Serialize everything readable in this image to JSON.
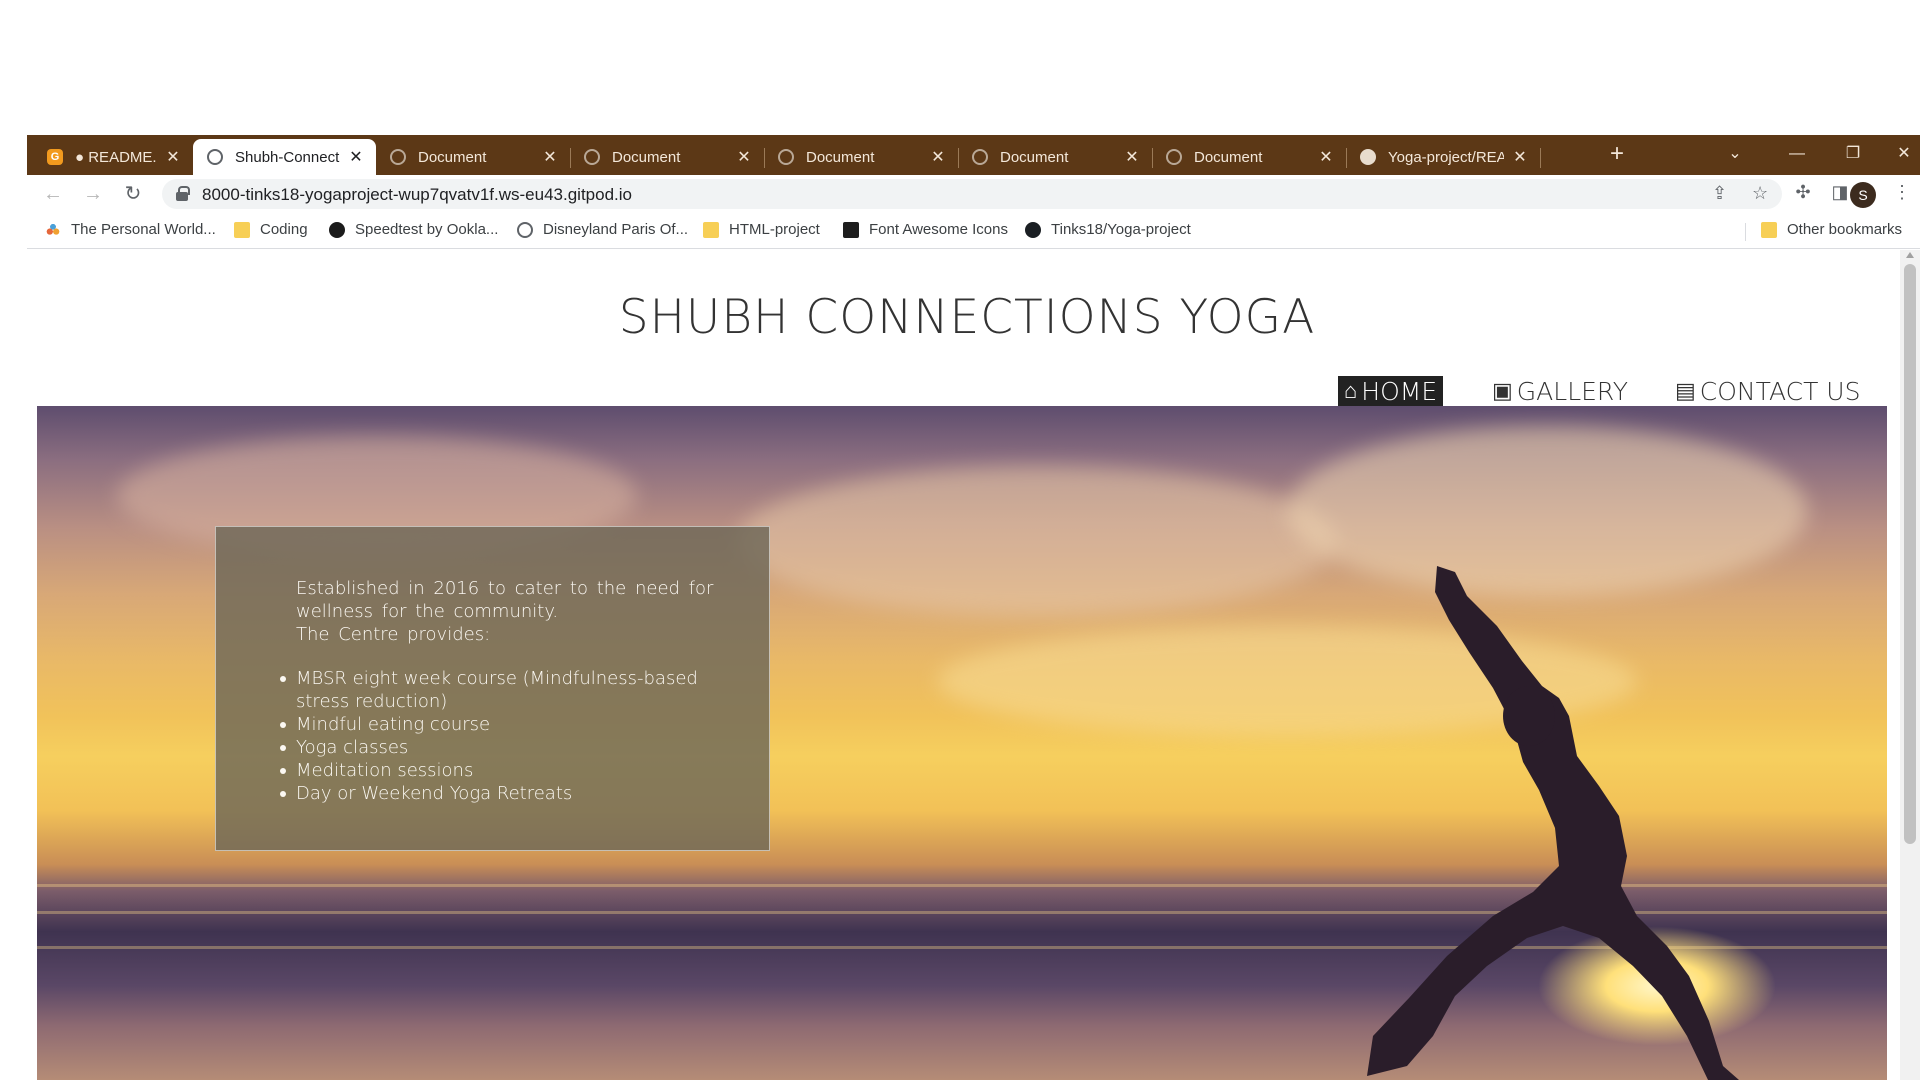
{
  "browser": {
    "tabs": [
      {
        "title": "● README.md - Y",
        "icon": "gitpod-icon",
        "active": false
      },
      {
        "title": "Shubh-Connectio",
        "icon": "globe-icon",
        "active": true
      },
      {
        "title": "Document",
        "icon": "globe-icon",
        "active": false
      },
      {
        "title": "Document",
        "icon": "globe-icon",
        "active": false
      },
      {
        "title": "Document",
        "icon": "globe-icon",
        "active": false
      },
      {
        "title": "Document",
        "icon": "globe-icon",
        "active": false
      },
      {
        "title": "Document",
        "icon": "globe-icon",
        "active": false
      },
      {
        "title": "Yoga-project/REA",
        "icon": "github-icon",
        "active": false
      }
    ],
    "url": "8000-tinks18-yogaproject-wup7qvatv1f.ws-eu43.gitpod.io",
    "profile_initial": "S",
    "bookmarks": [
      {
        "label": "The Personal World...",
        "icon": "personal-world-icon"
      },
      {
        "label": "Coding",
        "icon": "folder-icon"
      },
      {
        "label": "Speedtest by Ookla...",
        "icon": "speedtest-icon"
      },
      {
        "label": "Disneyland Paris Of...",
        "icon": "globe-icon"
      },
      {
        "label": "HTML-project",
        "icon": "folder-icon"
      },
      {
        "label": "Font Awesome Icons",
        "icon": "font-awesome-icon"
      },
      {
        "label": "Tinks18/Yoga-project",
        "icon": "github-icon"
      }
    ],
    "other_bookmarks": "Other bookmarks",
    "tab_bar_color": "#5c3816"
  },
  "site": {
    "title": "SHUBH CONNECTIONS YOGA",
    "nav": [
      {
        "label": "HOME",
        "icon": "home-icon",
        "active": true
      },
      {
        "label": "GALLERY",
        "icon": "image-icon",
        "active": false
      },
      {
        "label": "CONTACT US",
        "icon": "contact-card-icon",
        "active": false
      }
    ],
    "intro_line1": "Established in 2016 to cater to the need for wellness for the community.",
    "intro_line2": "The Centre provides:",
    "services": [
      "MBSR eight week course (Mindfulness-based stress reduction)",
      "Mindful eating course",
      "Yoga classes",
      "Meditation sessions",
      "Day or Weekend Yoga Retreats"
    ]
  }
}
